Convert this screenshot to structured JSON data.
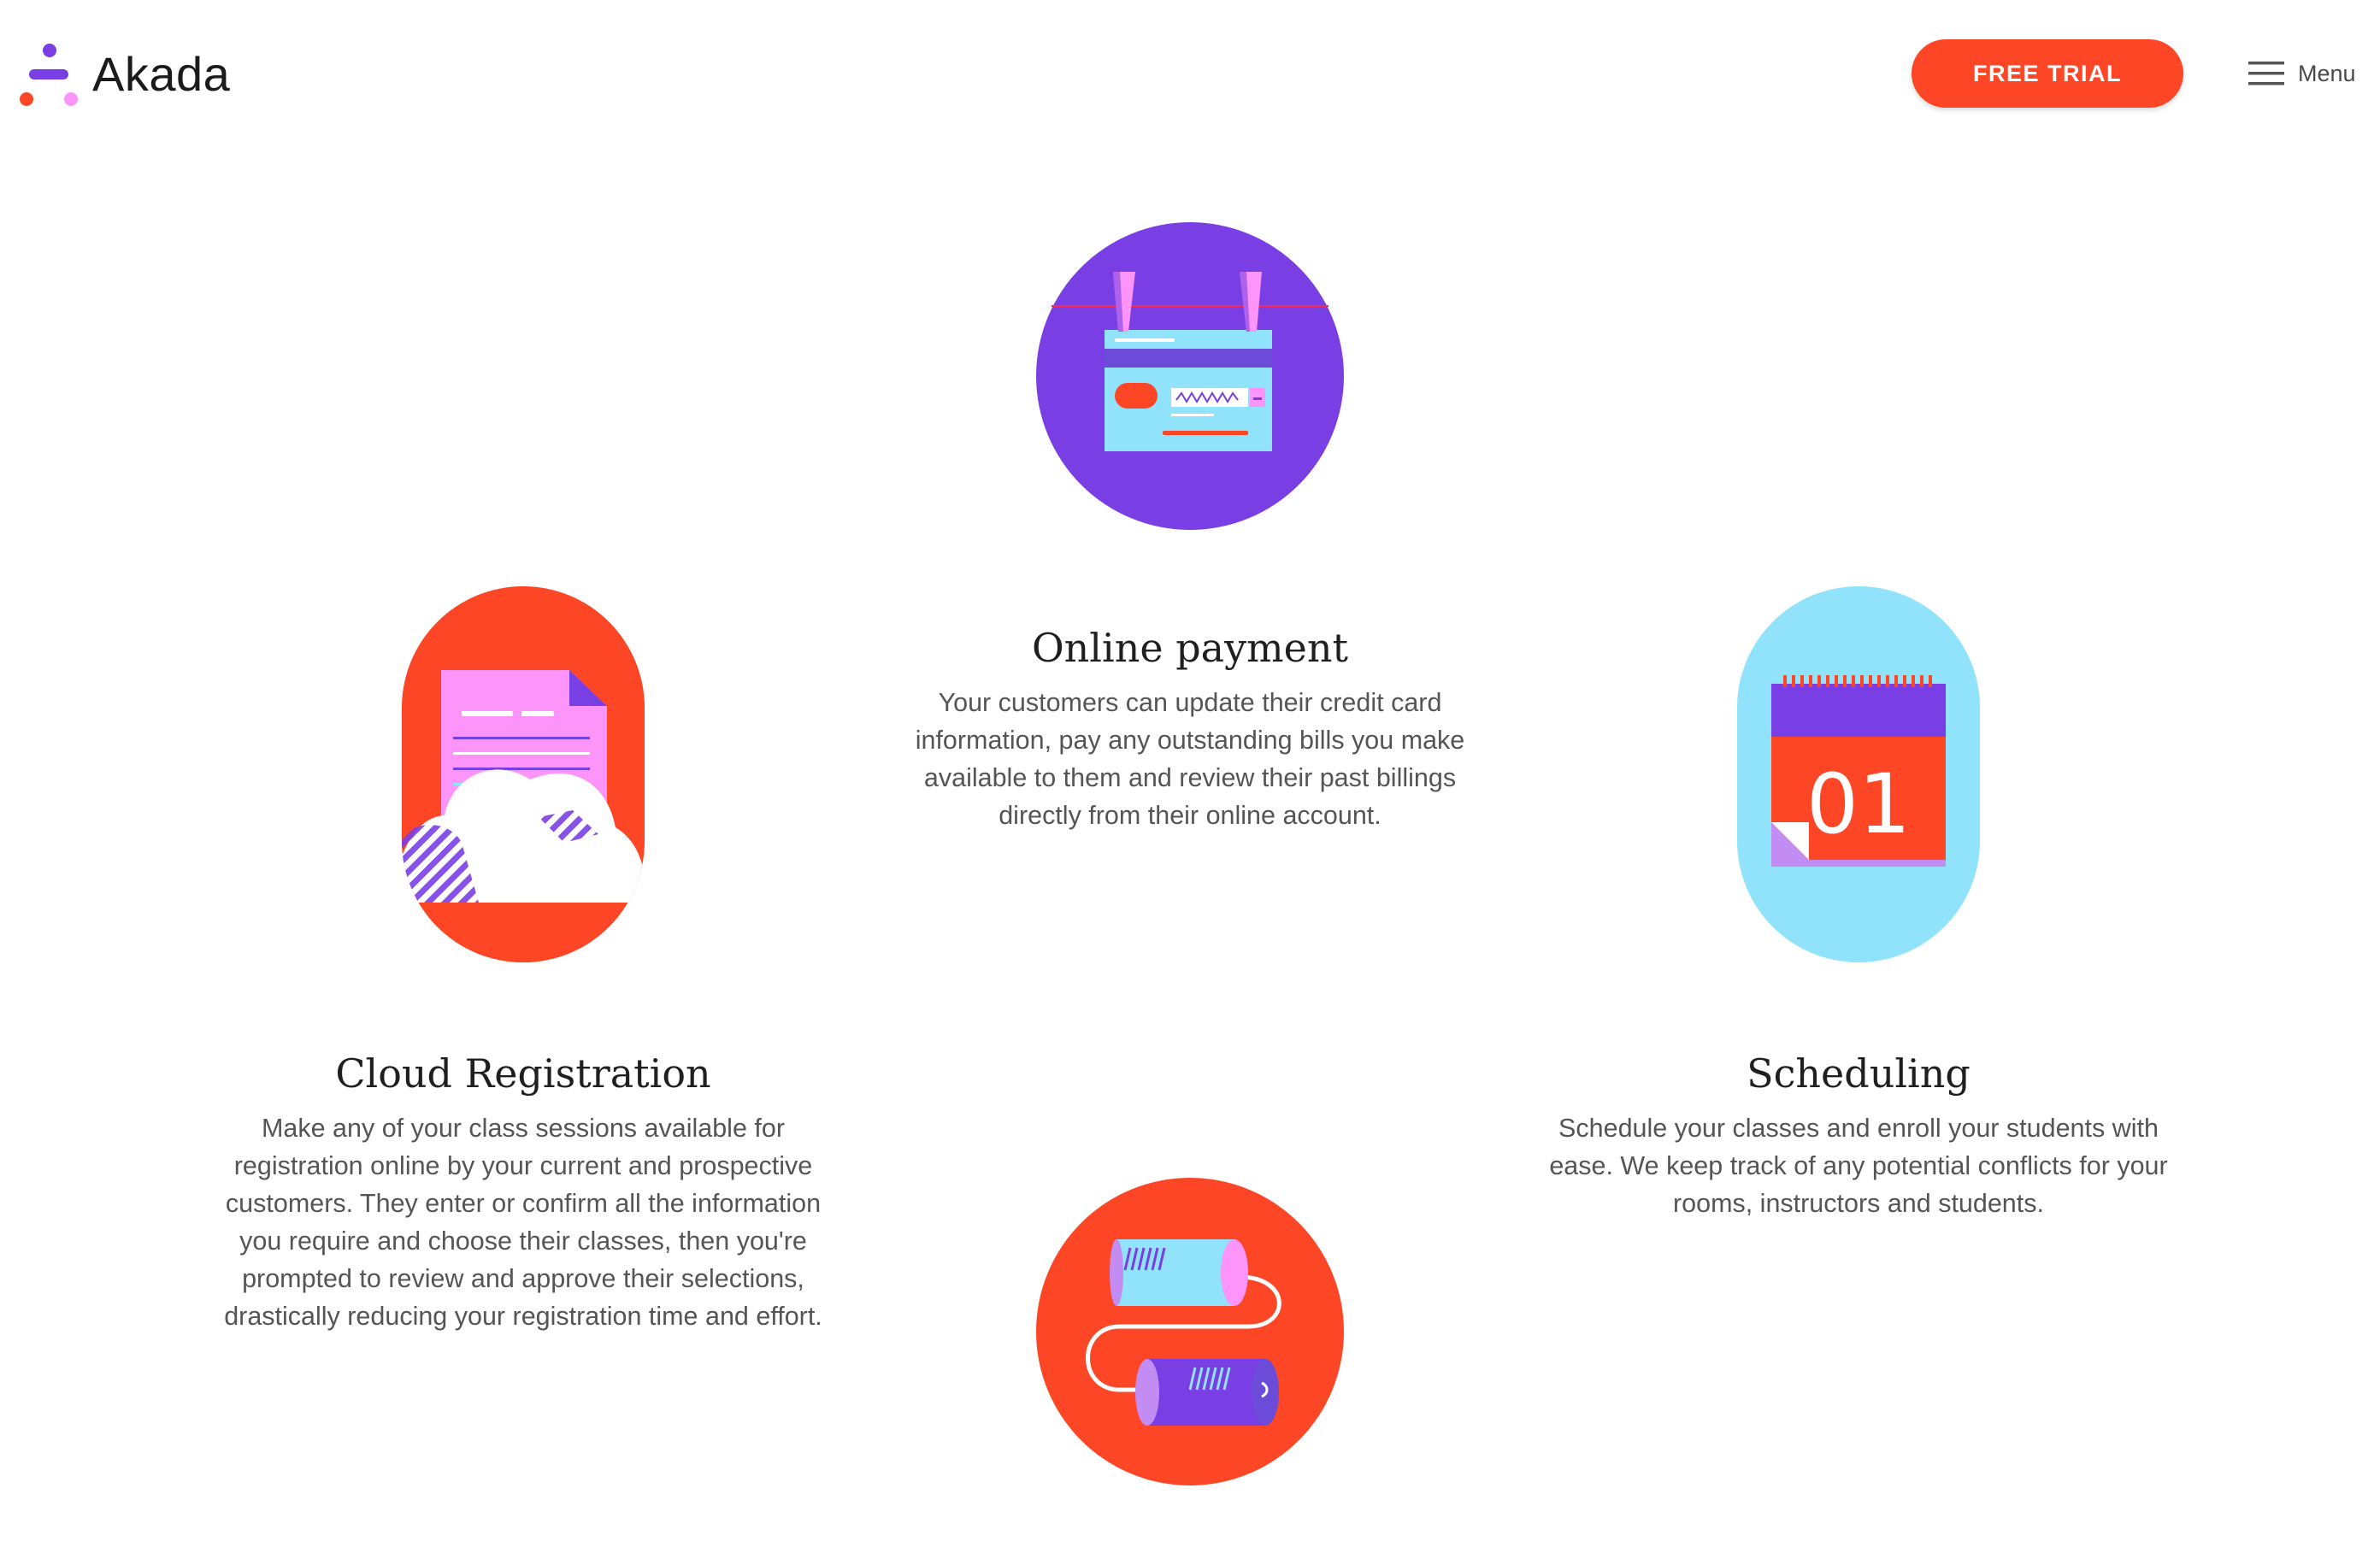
{
  "header": {
    "logo_text": "Akada",
    "cta_label": "FREE TRIAL",
    "menu_label": "Menu"
  },
  "features": {
    "online_payment": {
      "title": "Online payment",
      "description": "Your customers can update their credit card information, pay any outstanding bills you make available to them and review their past billings directly from their online account."
    },
    "cloud_registration": {
      "title": "Cloud Registration",
      "description": "Make any of your class sessions available for registration online by your current and prospective customers. They enter or confirm all the information you require and choose their classes, then you're prompted to review and approve their selections, drastically reducing your registration time and effort."
    },
    "scheduling": {
      "title": "Scheduling",
      "description": "Schedule your classes and enroll your students with ease. We keep track of any potential conflicts for your rooms, instructors and students.",
      "calendar_day": "01"
    }
  },
  "colors": {
    "brand_orange": "#fc4625",
    "brand_purple": "#7a3fe4",
    "sky_blue": "#90e3fb",
    "pink": "#fc94f9",
    "dark_purple": "#6b4bd8"
  },
  "icons": {
    "logo": "akada-logo-icon",
    "menu": "hamburger-menu-icon",
    "payment": "credit-card-illustration",
    "registration": "cloud-document-illustration",
    "scheduling": "calendar-illustration",
    "communication": "tin-can-phone-illustration"
  }
}
